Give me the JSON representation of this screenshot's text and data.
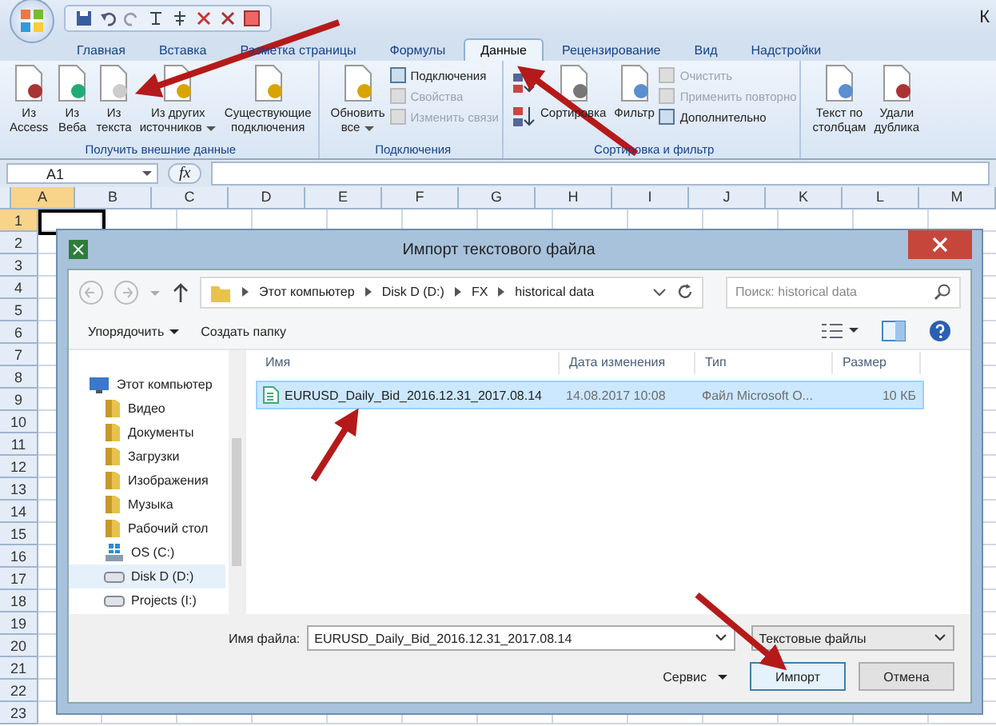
{
  "excel": {
    "title_fragment": "К",
    "tabs": [
      {
        "label": "Главная",
        "selected": false
      },
      {
        "label": "Вставка",
        "selected": false
      },
      {
        "label": "Разметка страницы",
        "selected": false
      },
      {
        "label": "Формулы",
        "selected": false
      },
      {
        "label": "Данные",
        "selected": true
      },
      {
        "label": "Рецензирование",
        "selected": false
      },
      {
        "label": "Вид",
        "selected": false
      },
      {
        "label": "Надстройки",
        "selected": false
      }
    ],
    "ribbon_groups": [
      {
        "label": "Получить внешние данные",
        "items": [
          {
            "kind": "large",
            "lines": [
              "Из",
              "Access"
            ],
            "dropdown": false
          },
          {
            "kind": "large",
            "lines": [
              "Из",
              "Веба"
            ],
            "dropdown": false
          },
          {
            "kind": "large",
            "lines": [
              "Из",
              "текста"
            ],
            "dropdown": false
          },
          {
            "kind": "large",
            "lines": [
              "Из других",
              "источников"
            ],
            "dropdown": true
          },
          {
            "kind": "large",
            "lines": [
              "Существующие",
              "подключения"
            ],
            "dropdown": false
          }
        ]
      },
      {
        "label": "Подключения",
        "items": [
          {
            "kind": "large",
            "lines": [
              "Обновить",
              "все"
            ],
            "dropdown": true
          },
          {
            "kind": "stack",
            "items": [
              {
                "label": "Подключения",
                "disabled": false
              },
              {
                "label": "Свойства",
                "disabled": true
              },
              {
                "label": "Изменить связи",
                "disabled": true
              }
            ]
          }
        ]
      },
      {
        "label": "Сортировка и фильтр",
        "items": [
          {
            "kind": "icons"
          },
          {
            "kind": "large",
            "lines": [
              "Сортировка"
            ],
            "dropdown": false
          },
          {
            "kind": "large",
            "lines": [
              "Фильтр"
            ],
            "dropdown": false
          },
          {
            "kind": "stack",
            "items": [
              {
                "label": "Очистить",
                "disabled": true
              },
              {
                "label": "Применить повторно",
                "disabled": true
              },
              {
                "label": "Дополнительно",
                "disabled": false
              }
            ]
          }
        ]
      },
      {
        "items": [
          {
            "kind": "large",
            "lines": [
              "Текст по",
              "столбцам"
            ],
            "dropdown": false
          },
          {
            "kind": "large",
            "lines": [
              "Удали",
              "дублика"
            ],
            "dropdown": false
          }
        ]
      }
    ],
    "name_box": "A1",
    "fx": "fx",
    "columns": [
      "A",
      "B",
      "C",
      "D",
      "E",
      "F",
      "G",
      "H",
      "I",
      "J",
      "K",
      "L",
      "M"
    ],
    "rows": [
      "1",
      "2",
      "3",
      "4",
      "5",
      "6",
      "7",
      "8",
      "9",
      "10",
      "11",
      "12",
      "13",
      "14",
      "15",
      "16",
      "17",
      "18",
      "19",
      "20",
      "21",
      "22",
      "23"
    ]
  },
  "dialog": {
    "title": "Импорт текстового файла",
    "breadcrumb": [
      "Этот компьютер",
      "Disk D (D:)",
      "FX",
      "historical data"
    ],
    "search_placeholder": "Поиск: historical data",
    "organize": "Упорядочить",
    "new_folder": "Создать папку",
    "columns": [
      "Имя",
      "Дата изменения",
      "Тип",
      "Размер"
    ],
    "files": [
      {
        "name": "EURUSD_Daily_Bid_2016.12.31_2017.08.14",
        "date": "14.08.2017 10:08",
        "type": "Файл Microsoft O...",
        "size": "10 КБ",
        "selected": true
      }
    ],
    "nav": [
      {
        "label": "Этот компьютер",
        "kind": "computer",
        "selected": false,
        "children": [
          {
            "label": "Видео",
            "kind": "folder",
            "selected": false
          },
          {
            "label": "Документы",
            "kind": "folder",
            "selected": false
          },
          {
            "label": "Загрузки",
            "kind": "folder",
            "selected": false
          },
          {
            "label": "Изображения",
            "kind": "folder",
            "selected": false
          },
          {
            "label": "Музыка",
            "kind": "folder",
            "selected": false
          },
          {
            "label": "Рабочий стол",
            "kind": "folder",
            "selected": false
          },
          {
            "label": "OS (C:)",
            "kind": "system-drive",
            "selected": false
          },
          {
            "label": "Disk D (D:)",
            "kind": "drive",
            "selected": true
          },
          {
            "label": "Projects (I:)",
            "kind": "drive",
            "selected": false
          }
        ]
      }
    ],
    "filename_label": "Имя файла:",
    "filename": "EURUSD_Daily_Bid_2016.12.31_2017.08.14",
    "filetype": "Текстовые файлы",
    "tools": "Сервис",
    "buttons": [
      {
        "label": "Импорт",
        "default": true
      },
      {
        "label": "Отмена",
        "default": false
      }
    ]
  }
}
